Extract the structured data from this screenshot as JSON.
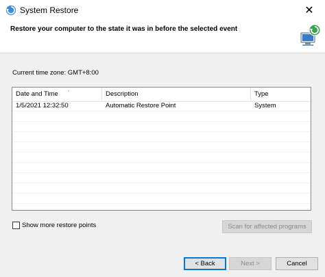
{
  "window": {
    "title": "System Restore",
    "close_glyph": "✕"
  },
  "header": {
    "instruction": "Restore your computer to the state it was in before the selected event",
    "icon": "system-restore-computer-icon"
  },
  "timezone_label": "Current time zone: GMT+8:00",
  "table": {
    "columns": [
      "Date and Time",
      "Description",
      "Type"
    ],
    "rows": [
      {
        "date": "1/5/2021 12:32:50",
        "description": "Automatic Restore Point",
        "type": "System"
      }
    ]
  },
  "options": {
    "show_more_label": "Show more restore points",
    "show_more_checked": false
  },
  "buttons": {
    "scan": "Scan for affected programs",
    "back": "< Back",
    "next": "Next >",
    "cancel": "Cancel"
  },
  "colors": {
    "accent": "#0078d7",
    "dialog_bg": "#f0f0f0"
  }
}
